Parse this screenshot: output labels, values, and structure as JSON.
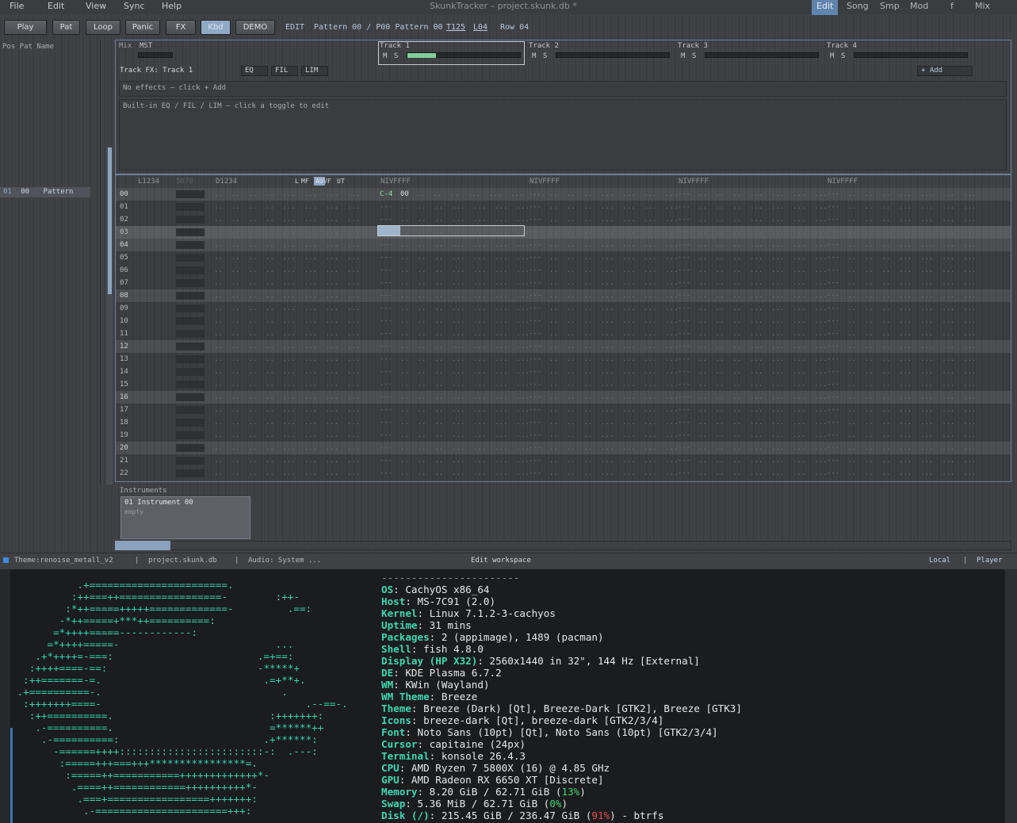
{
  "menubar": {
    "items": [
      "File",
      "Edit",
      "View",
      "Sync",
      "Help"
    ],
    "title": "SkunkTracker – project.skunk.db *",
    "right_items": [
      "Edit",
      "Song",
      "Smp",
      "Mod",
      "f",
      "Mix"
    ],
    "right_active": "Edit"
  },
  "toolbar": {
    "buttons": [
      {
        "label": "Play",
        "on": false
      },
      {
        "label": "Pat",
        "on": false
      },
      {
        "label": "Loop",
        "on": false
      },
      {
        "label": "Panic",
        "on": false
      },
      {
        "label": "FX",
        "on": false
      },
      {
        "label": "Kbd",
        "on": true
      },
      {
        "label": "DEMO",
        "on": false
      }
    ],
    "mode": "EDIT",
    "pattern_info": "Pattern 00 / P00 Pattern 00",
    "tempo": "T125",
    "lines": "L04",
    "row": "Row 04"
  },
  "songlist": {
    "header": "Pos Pat Name",
    "rows": [
      {
        "pos": "01",
        "pat": "00",
        "name": "Pattern"
      }
    ]
  },
  "mixer": {
    "label": "Mix",
    "master": "MST",
    "tracks": [
      {
        "name": "Track 1",
        "mute": "M",
        "solo": "S",
        "level": 0.25
      },
      {
        "name": "Track 2",
        "mute": "M",
        "solo": "S",
        "level": 0
      },
      {
        "name": "Track 3",
        "mute": "M",
        "solo": "S",
        "level": 0
      },
      {
        "name": "Track 4",
        "mute": "M",
        "solo": "S",
        "level": 0
      }
    ]
  },
  "trackfx": {
    "label": "Track FX: Track 1",
    "toggles": [
      "EQ",
      "FIL",
      "LIM"
    ],
    "add": "+ Add",
    "empty": "No effects – click + Add",
    "hint": "Built-in EQ / FIL / LIM – click a toggle to edit"
  },
  "pattern": {
    "col_headers": [
      "L1234",
      "5678",
      "D1234"
    ],
    "toggles": [
      {
        "label": "L",
        "on": false
      },
      {
        "label": "MF",
        "on": false
      },
      {
        "label": "AU",
        "on": true
      },
      {
        "label": "VF",
        "on": false
      },
      {
        "label": "UT",
        "on": false
      }
    ],
    "track_header": "NIVFFFF",
    "rows": [
      "00",
      "01",
      "02",
      "03",
      "04",
      "05",
      "06",
      "07",
      "08",
      "09",
      "10",
      "11",
      "12",
      "13",
      "14",
      "15",
      "16",
      "17",
      "18",
      "19",
      "20",
      "21",
      "22"
    ],
    "first_note": "C-4",
    "first_instr": "00",
    "empty_note": "---",
    "dots_left": "..  ..  ..  ..  ...  ...  ...  ...",
    "dots_track": "..  ..  ..  ...  ...  ...  ..."
  },
  "instruments": {
    "label": "Instruments",
    "items": [
      {
        "name": "01 Instrument 00",
        "sub": "empty"
      }
    ]
  },
  "statusbar": {
    "theme": "Theme:renoise_metall_v2",
    "file": "project.skunk.db",
    "audio": "Audio: System ...",
    "center": "Edit workspace",
    "local": "Local",
    "player": "Player"
  },
  "terminal": {
    "art": [
      "           .+=======================.",
      "          :++===++=================-        :++-",
      "         :*++=====+++++=============-         .==:",
      "        -*++=====+***++==========:",
      "       =*++++=====------------:",
      "      =*++++=====-                          ...",
      "    .+*++++=-===:                        .=+==:",
      "   :++++====-==:                         -*****+",
      "  :++=======-=.                           .=+**+.",
      " .+==========-.                              .",
      "  :+++++++====-                                  .--==-.",
      "   :++==========.                          :+++++++:",
      "    .-==========.                          =******++",
      "     .-==========:                        .+******:",
      "       -======++++::::::::::::::::::::::::-:  .---:",
      "        :=====+++===+++****************=.",
      "         :=====++===========+++++++++++++*-",
      "          .====++============++++++++++*-",
      "           .===+=================+++++++:",
      "            .-======================+++:",
      "              ........................"
    ],
    "info": [
      {
        "k": "OS",
        "v": "CachyOS x86_64"
      },
      {
        "k": "Host",
        "v": "MS-7C91 (2.0)"
      },
      {
        "k": "Kernel",
        "v": "Linux 7.1.2-3-cachyos"
      },
      {
        "k": "Uptime",
        "v": "31 mins"
      },
      {
        "k": "Packages",
        "v": "2 (appimage), 1489 (pacman)"
      },
      {
        "k": "Shell",
        "v": "fish 4.8.0"
      },
      {
        "k": "Display (HP X32)",
        "v": "2560x1440 in 32\", 144 Hz [External]"
      },
      {
        "k": "DE",
        "v": "KDE Plasma 6.7.2"
      },
      {
        "k": "WM",
        "v": "KWin (Wayland)"
      },
      {
        "k": "WM Theme",
        "v": "Breeze"
      },
      {
        "k": "Theme",
        "v": "Breeze (Dark) [Qt], Breeze-Dark [GTK2], Breeze [GTK3]"
      },
      {
        "k": "Icons",
        "v": "breeze-dark [Qt], breeze-dark [GTK2/3/4]"
      },
      {
        "k": "Font",
        "v": "Noto Sans (10pt) [Qt], Noto Sans (10pt) [GTK2/3/4]"
      },
      {
        "k": "Cursor",
        "v": "capitaine (24px)"
      },
      {
        "k": "Terminal",
        "v": "konsole 26.4.3"
      },
      {
        "k": "CPU",
        "v": "AMD Ryzen 7 5800X (16) @ 4.85 GHz"
      },
      {
        "k": "GPU",
        "v": "AMD Radeon RX 6650 XT [Discrete]"
      },
      {
        "k": "Memory",
        "v": "8.20 GiB / 62.71 GiB (",
        "p": "13%",
        "pc": "g",
        "t": ")"
      },
      {
        "k": "Swap",
        "v": "5.36 MiB / 62.71 GiB (",
        "p": "0%",
        "pc": "g",
        "t": ")"
      },
      {
        "k": "Disk (/)",
        "v": "215.45 GiB / 236.47 GiB (",
        "p": "91%",
        "pc": "r",
        "t": ") - btrfs"
      }
    ],
    "separator": "-----------------------"
  },
  "colors": {
    "accent": "#5f84ad",
    "note_green": "#8fe3a7",
    "term_cyan": "#34d6ad",
    "meter": "#7fcf9a"
  }
}
